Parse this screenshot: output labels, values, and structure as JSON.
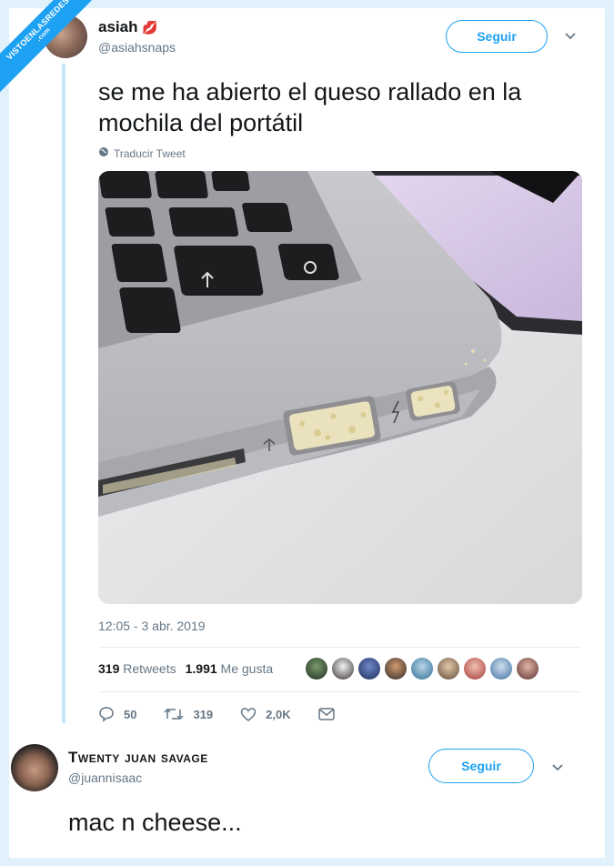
{
  "watermark": {
    "line1": "VISTOENLASREDES",
    "line2": ".com"
  },
  "tweet": {
    "name": "asiah",
    "name_emoji": "💋",
    "handle": "@asiahsnaps",
    "follow_label": "Seguir",
    "text_line1": "se me ha abierto el queso rallado en la",
    "text_line2": "mochila del portátil",
    "translate_label": "Traducir Tweet",
    "timestamp": "12:05 - 3 abr. 2019",
    "retweets_count": "319",
    "retweets_label": "Retweets",
    "likes_count": "1.991",
    "likes_label": "Me gusta",
    "actions": {
      "replies": "50",
      "retweets": "319",
      "likes": "2,0K"
    }
  },
  "reply": {
    "name": "Twenty juan savage",
    "handle": "@juannisaac",
    "follow_label": "Seguir",
    "text": "mac n cheese..."
  },
  "colors": {
    "accent": "#1da1f2",
    "frame": "#e1f1fc",
    "muted": "#657786"
  },
  "icons": [
    "reply-icon",
    "retweet-icon",
    "like-icon",
    "message-icon",
    "globe-icon",
    "chevron-down-icon"
  ]
}
